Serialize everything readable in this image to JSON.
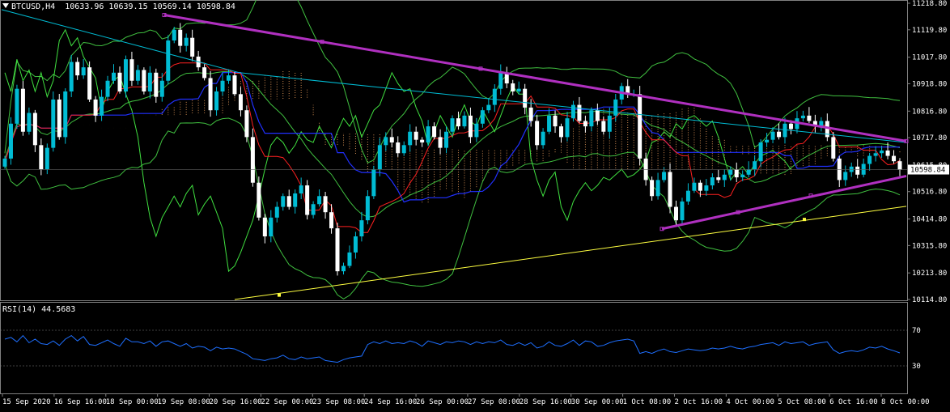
{
  "header": {
    "symbol": "BTCUSD,H4",
    "ohlc": "10633.96 10639.15 10569.14 10598.84"
  },
  "rsi": {
    "label": "RSI(14) 44.5683",
    "levels": [
      "70",
      "30"
    ],
    "line_color": "#1e6fff"
  },
  "colors": {
    "background": "#000000",
    "bull_candle": "#00bcd4",
    "bear_candle": "#ffffff",
    "trendline_triangle": "#b030c0",
    "trendline_cyan": "#00bcd4",
    "trendline_yellow": "#ffff40",
    "tenkan": "#ff2020",
    "kijun": "#2030ff",
    "bands": "#40c040",
    "chikou": "#40e040",
    "cloud": "#f4a460"
  },
  "chart_data": {
    "type": "candlestick",
    "symbol": "BTCUSD",
    "timeframe": "H4",
    "last_price": "10598.84",
    "y_ticks": [
      "11218.80",
      "11119.80",
      "11017.80",
      "10918.80",
      "10816.80",
      "10717.80",
      "10615.80",
      "10516.80",
      "10414.80",
      "10315.80",
      "10213.80",
      "10114.80"
    ],
    "ylim": [
      10114.8,
      11218.8
    ],
    "x_ticks": [
      "15 Sep 2020",
      "16 Sep 16:00",
      "18 Sep 00:00",
      "19 Sep 08:00",
      "20 Sep 16:00",
      "22 Sep 00:00",
      "23 Sep 08:00",
      "24 Sep 16:00",
      "26 Sep 00:00",
      "27 Sep 08:00",
      "28 Sep 16:00",
      "30 Sep 00:00",
      "1 Oct 08:00",
      "2 Oct 16:00",
      "4 Oct 00:00",
      "5 Oct 08:00",
      "6 Oct 16:00",
      "8 Oct 00:00"
    ],
    "closes": [
      10640,
      10770,
      10900,
      10740,
      10810,
      10690,
      10600,
      10680,
      10860,
      10720,
      10890,
      11000,
      10950,
      10980,
      10860,
      10800,
      10870,
      10930,
      10960,
      10890,
      11010,
      10930,
      10970,
      10890,
      10960,
      10870,
      10930,
      11080,
      11120,
      11060,
      11090,
      11020,
      10980,
      10940,
      10820,
      10890,
      10930,
      10950,
      10880,
      10820,
      10720,
      10550,
      10420,
      10350,
      10420,
      10460,
      10500,
      10460,
      10510,
      10540,
      10430,
      10470,
      10500,
      10440,
      10380,
      10220,
      10240,
      10290,
      10350,
      10410,
      10500,
      10600,
      10690,
      10720,
      10700,
      10660,
      10690,
      10740,
      10710,
      10700,
      10760,
      10720,
      10680,
      10740,
      10790,
      10760,
      10800,
      10720,
      10770,
      10820,
      10840,
      10900,
      10960,
      10920,
      10890,
      10900,
      10830,
      10780,
      10690,
      10740,
      10800,
      10760,
      10720,
      10790,
      10840,
      10780,
      10760,
      10820,
      10780,
      10740,
      10800,
      10860,
      10910,
      10880,
      10880,
      10640,
      10560,
      10500,
      10560,
      10590,
      10460,
      10410,
      10480,
      10520,
      10550,
      10520,
      10540,
      10570,
      10560,
      10580,
      10600,
      10570,
      10580,
      10600,
      10630,
      10700,
      10710,
      10740,
      10720,
      10770,
      10750,
      10790,
      10800,
      10780,
      10760,
      10780,
      10720,
      10640,
      10560,
      10590,
      10610,
      10580,
      10620,
      10650,
      10660,
      10670,
      10650,
      10630,
      10598.84
    ],
    "rsi_values": [
      60,
      62,
      57,
      64,
      56,
      60,
      55,
      54,
      58,
      53,
      60,
      64,
      58,
      63,
      54,
      53,
      56,
      59,
      55,
      52,
      61,
      57,
      57,
      55,
      58,
      52,
      57,
      58,
      55,
      52,
      55,
      50,
      52,
      51,
      47,
      51,
      49,
      50,
      49,
      46,
      43,
      38,
      37,
      36,
      38,
      39,
      42,
      38,
      37,
      40,
      38,
      39,
      40,
      36,
      35,
      34,
      37,
      39,
      40,
      41,
      54,
      57,
      55,
      58,
      55,
      56,
      55,
      58,
      56,
      52,
      58,
      56,
      54,
      57,
      56,
      58,
      57,
      54,
      57,
      55,
      57,
      56,
      59,
      54,
      53,
      56,
      53,
      56,
      50,
      52,
      57,
      53,
      52,
      55,
      59,
      53,
      58,
      57,
      52,
      53,
      56,
      58,
      59,
      60,
      58,
      44,
      46,
      44,
      47,
      49,
      46,
      45,
      47,
      49,
      48,
      47,
      48,
      50,
      49,
      50,
      52,
      50,
      49,
      51,
      52,
      54,
      55,
      56,
      53,
      57,
      55,
      56,
      57,
      53,
      55,
      56,
      57,
      48,
      44,
      46,
      47,
      46,
      48,
      51,
      50,
      52,
      49,
      47,
      44.5683
    ]
  }
}
